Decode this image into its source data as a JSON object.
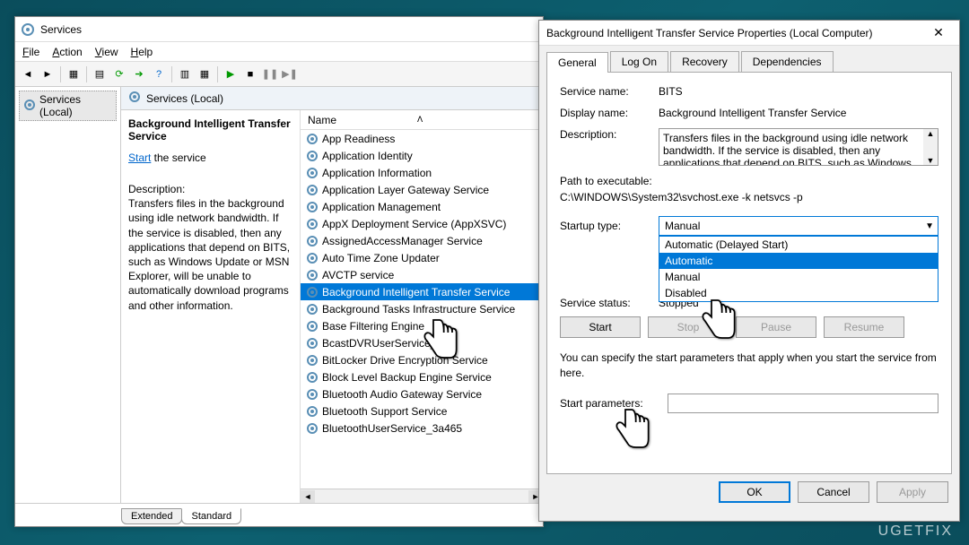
{
  "services_window": {
    "title": "Services",
    "menus": [
      "File",
      "Action",
      "View",
      "Help"
    ],
    "tree_label": "Services (Local)",
    "panel_header": "Services (Local)",
    "detail": {
      "service_name": "Background Intelligent Transfer Service",
      "start_text": "Start",
      "start_suffix": " the service",
      "desc_label": "Description:",
      "description": "Transfers files in the background using idle network bandwidth. If the service is disabled, then any applications that depend on BITS, such as Windows Update or MSN Explorer, will be unable to automatically download programs and other information."
    },
    "list_header": "Name",
    "items": [
      "App Readiness",
      "Application Identity",
      "Application Information",
      "Application Layer Gateway Service",
      "Application Management",
      "AppX Deployment Service (AppXSVC)",
      "AssignedAccessManager Service",
      "Auto Time Zone Updater",
      "AVCTP service",
      "Background Intelligent Transfer Service",
      "Background Tasks Infrastructure Service",
      "Base Filtering Engine",
      "BcastDVRUserService_",
      "BitLocker Drive Encryption Service",
      "Block Level Backup Engine Service",
      "Bluetooth Audio Gateway Service",
      "Bluetooth Support Service",
      "BluetoothUserService_3a465"
    ],
    "selected_index": 9,
    "tabs": {
      "extended": "Extended",
      "standard": "Standard"
    }
  },
  "properties": {
    "title": "Background Intelligent Transfer Service Properties (Local Computer)",
    "tabs": [
      "General",
      "Log On",
      "Recovery",
      "Dependencies"
    ],
    "active_tab": 0,
    "labels": {
      "service_name": "Service name:",
      "display_name": "Display name:",
      "description": "Description:",
      "path": "Path to executable:",
      "startup": "Startup type:",
      "status": "Service status:",
      "params": "Start parameters:"
    },
    "service_name": "BITS",
    "display_name": "Background Intelligent Transfer Service",
    "description": "Transfers files in the background using idle network bandwidth. If the service is disabled, then any applications that depend on BITS, such as Windows",
    "path": "C:\\WINDOWS\\System32\\svchost.exe -k netsvcs -p",
    "startup_value": "Manual",
    "startup_options": [
      "Automatic (Delayed Start)",
      "Automatic",
      "Manual",
      "Disabled"
    ],
    "startup_selected": 1,
    "status_value": "Stopped",
    "buttons": {
      "start": "Start",
      "stop": "Stop",
      "pause": "Pause",
      "resume": "Resume"
    },
    "help_text": "You can specify the start parameters that apply when you start the service from here.",
    "params_value": "",
    "dlg_buttons": {
      "ok": "OK",
      "cancel": "Cancel",
      "apply": "Apply"
    }
  },
  "watermark": "UGETFIX"
}
